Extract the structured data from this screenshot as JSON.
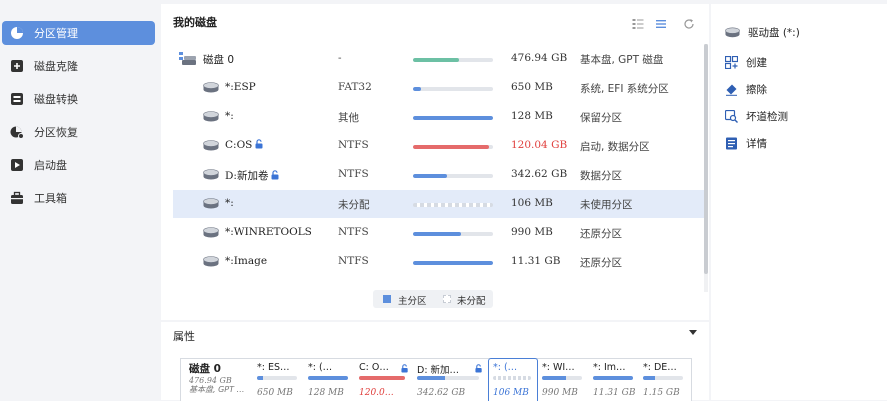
{
  "sidebar": {
    "items": [
      {
        "label": "分区管理",
        "icon": "pie-chart-icon",
        "active": true
      },
      {
        "label": "磁盘克隆",
        "icon": "clone-icon"
      },
      {
        "label": "磁盘转换",
        "icon": "convert-icon"
      },
      {
        "label": "分区恢复",
        "icon": "recover-icon"
      },
      {
        "label": "启动盘",
        "icon": "boot-disk-icon"
      },
      {
        "label": "工具箱",
        "icon": "toolbox-icon"
      }
    ]
  },
  "main": {
    "title": "我的磁盘",
    "toolbar_icons": [
      "grid-view-icon",
      "list-view-icon",
      "refresh-icon"
    ],
    "rows": [
      {
        "name": "磁盘 0",
        "fs": "-",
        "usage": 0.58,
        "color": "#6cc0a4",
        "size": "476.94 GB",
        "type": "基本盘, GPT 磁盘",
        "level": 0
      },
      {
        "name": "*:ESP",
        "fs": "FAT32",
        "usage": 0.1,
        "color": "#5d8fdd",
        "size": "650 MB",
        "type": "系统, EFI 系统分区",
        "level": 1
      },
      {
        "name": "*:",
        "fs": "其他",
        "usage": 1.0,
        "color": "#5d8fdd",
        "size": "128 MB",
        "type": "保留分区",
        "level": 1
      },
      {
        "name": "C:OS",
        "fs": "NTFS",
        "usage": 0.95,
        "color": "#e56b6b",
        "size": "120.04 GB",
        "size_warn": true,
        "type": "启动, 数据分区",
        "level": 1,
        "locked": true
      },
      {
        "name": "D:新加卷",
        "fs": "NTFS",
        "usage": 0.42,
        "color": "#5d8fdd",
        "size": "342.62 GB",
        "type": "数据分区",
        "level": 1,
        "locked": true
      },
      {
        "name": "*:",
        "fs": "未分配",
        "usage": 0,
        "color": "#d6dbe3",
        "size": "106 MB",
        "type": "未使用分区",
        "level": 1,
        "selected": true,
        "unallocated": true
      },
      {
        "name": "*:WINRETOOLS",
        "fs": "NTFS",
        "usage": 0.6,
        "color": "#5d8fdd",
        "size": "990 MB",
        "type": "还原分区",
        "level": 1
      },
      {
        "name": "*:Image",
        "fs": "NTFS",
        "usage": 1.0,
        "color": "#5d8fdd",
        "size": "11.31 GB",
        "type": "还原分区",
        "level": 1
      }
    ],
    "legend": {
      "primary": "主分区",
      "unallocated": "未分配",
      "primary_color": "#5d8fdd"
    }
  },
  "properties": {
    "title": "属性",
    "disk": {
      "label": "磁盘 0",
      "size": "476.94 GB",
      "type": "基本盘, GPT …"
    },
    "parts": [
      {
        "label": "*: ES…",
        "size": "650 MB",
        "usage": 0.15,
        "color": "#5d8fdd"
      },
      {
        "label": "*: (…",
        "size": "128 MB",
        "usage": 1.0,
        "color": "#5d8fdd"
      },
      {
        "label": "C: O…",
        "size": "120.0…",
        "usage": 1.0,
        "color": "#e56b6b",
        "locked": true,
        "warn": true
      },
      {
        "label": "D: 新加…",
        "size": "342.62 GB",
        "usage": 0.45,
        "color": "#5d8fdd",
        "locked": true
      },
      {
        "label": "*: (…",
        "size": "106 MB",
        "usage": 0,
        "color": "#d6dbe3",
        "selected": true
      },
      {
        "label": "*: WI…",
        "size": "990 MB",
        "usage": 0.6,
        "color": "#5d8fdd"
      },
      {
        "label": "*: Im…",
        "size": "11.31 GB",
        "usage": 1.0,
        "color": "#5d8fdd"
      },
      {
        "label": "*: DE…",
        "size": "1.15 GB",
        "usage": 0.3,
        "color": "#5d8fdd"
      }
    ]
  },
  "right_panel": {
    "header": "驱动盘 (*:)",
    "actions": [
      {
        "label": "创建",
        "icon": "create-icon"
      },
      {
        "label": "擦除",
        "icon": "eraser-icon"
      },
      {
        "label": "坏道检测",
        "icon": "bad-sector-scan-icon"
      },
      {
        "label": "详情",
        "icon": "details-icon"
      }
    ]
  }
}
